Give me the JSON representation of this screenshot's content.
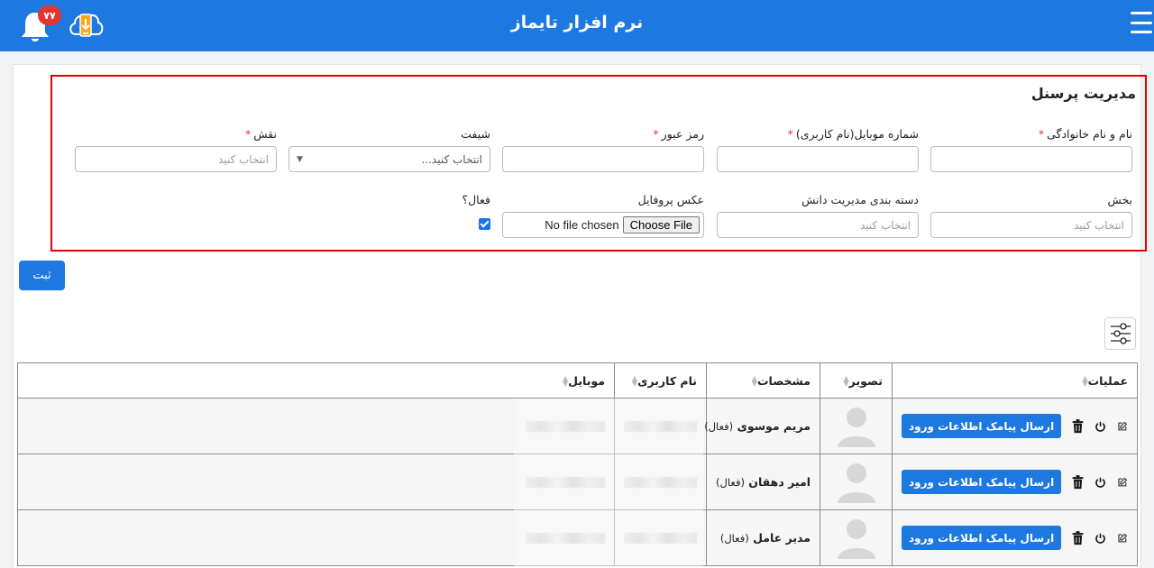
{
  "header": {
    "title": "نرم افزار تایماز",
    "notification_count": "۷۷"
  },
  "form": {
    "title": "مدیریت پرسنل",
    "fullname": {
      "label": "نام و نام خانوادگی",
      "value": ""
    },
    "mobile": {
      "label": "شماره موبایل(نام کاربری)",
      "value": ""
    },
    "password": {
      "label": "رمز عبور",
      "value": ""
    },
    "shift": {
      "label": "شیفت",
      "selected": "انتخاب کنید..."
    },
    "role": {
      "label": "نقش",
      "placeholder": "انتخاب کنید"
    },
    "department": {
      "label": "بخش",
      "placeholder": "انتخاب کنید"
    },
    "knowledge_category": {
      "label": "دسته بندی مدیریت دانش",
      "placeholder": "انتخاب کنید"
    },
    "profile_photo": {
      "label": "عکس پروفایل",
      "button": "Choose File",
      "status": "No file chosen"
    },
    "active": {
      "label": "فعال؟",
      "checked": true
    },
    "submit_label": "ثبت"
  },
  "table": {
    "columns": [
      "عملیات",
      "تصویر",
      "مشخصات",
      "نام کاربری",
      "موبایل"
    ],
    "sms_label": "ارسال پیامک اطلاعات ورود",
    "rows": [
      {
        "name": "مریم موسوی",
        "status": "(فعال)"
      },
      {
        "name": "امیر دهقان",
        "status": "(فعال)"
      },
      {
        "name": "مدیر عامل",
        "status": "(فعال)"
      }
    ]
  },
  "colors": {
    "primary": "#1d78e0",
    "required": "#e3342f",
    "highlight": "#e00000"
  }
}
